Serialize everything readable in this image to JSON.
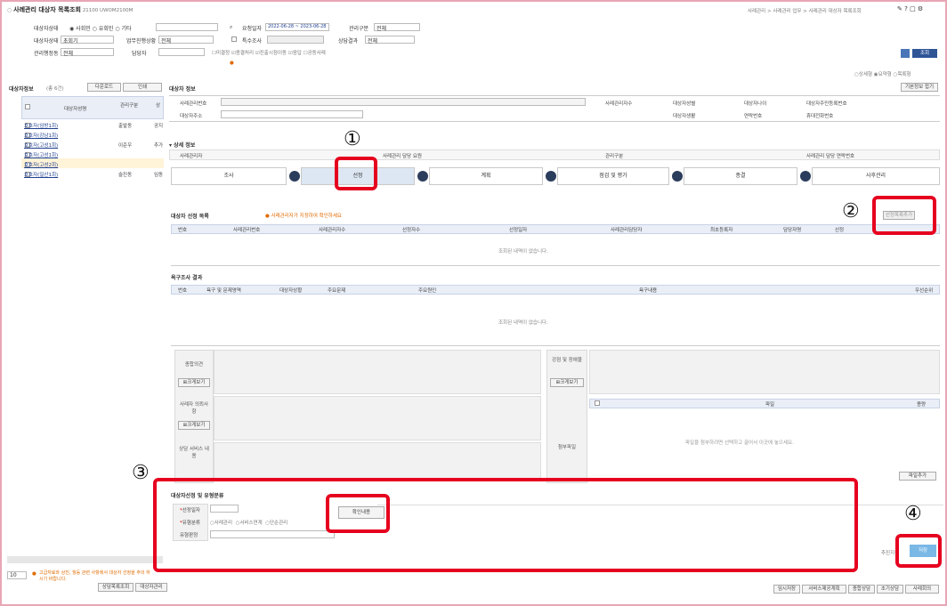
{
  "window": {
    "title": "사례관리 대상자 목록조회",
    "code": "21100 UWOM2100M"
  },
  "header_links": [
    "사례관리",
    "사례관리 업무",
    "사례관리 대상자 목록조회"
  ],
  "filters": {
    "status_label": "대상자상태",
    "status_options": [
      "사회민",
      "유회민",
      "기타"
    ],
    "reg_date_label": "요청일자",
    "reg_date_value": "2022-06-28 ~ 2023-06-28",
    "manage_type_label": "관리구분",
    "manage_type_value": "전체",
    "status2_label": "대상자상태",
    "status2_value": "초회기",
    "org_label": "업무진행상황",
    "org_value": "전체",
    "region_label": "특수조사",
    "consult_label": "상담결과",
    "consult_value": "전체",
    "worker_label": "관리행정동",
    "worker_value": "전체",
    "manager_label": "담당자",
    "checks": [
      "미결정",
      "종결처리",
      "진출시점이동",
      "응답",
      "공동사례"
    ]
  },
  "right_buttons": {
    "search": "조회",
    "radio": [
      "상세형",
      "요약형",
      "목록형"
    ]
  },
  "left_panel": {
    "title": "대상자정보",
    "count": "(총 6건)",
    "btn_excel": "다운로드",
    "btn_layout": "인쇄",
    "columns": [
      "대상자성명",
      "관리구분",
      "상"
    ],
    "rows": [
      {
        "name": "호호자(임방1회)",
        "type": "출발동",
        "c": "공지"
      },
      {
        "name": "호호자(강남1회)",
        "type": "",
        "c": ""
      },
      {
        "name": "호호자(고성1회)",
        "type": "이준우",
        "c": "추가"
      },
      {
        "name": "호호자(고성1회)",
        "type": "",
        "c": ""
      },
      {
        "name": "호호자(고성2회)",
        "type": "",
        "c": ""
      },
      {
        "name": "호호자(일산1회)",
        "type": "슬진동",
        "c": "임동"
      }
    ],
    "pager": "10",
    "footer_btns": [
      "상담목록조회",
      "대상자관리"
    ]
  },
  "detail": {
    "title": "대상자 정보",
    "btn_fold": "기본정보 접기",
    "fields": [
      "사례관리번호",
      "사례관리자수",
      "대상자성별",
      "대상자나이",
      "대상자주민등록번호",
      "대상자주소",
      "대상자생활",
      "연락번호",
      "휴대전화번호"
    ],
    "sub_title": "상세 정보",
    "sub_fields": [
      "사례관리자",
      "사례관리 담당 요원",
      "관리구분",
      "사례관리 담당 연락번호"
    ]
  },
  "steps": [
    "조사",
    "선정",
    "계획",
    "점검 및 평가",
    "종결",
    "사후관리"
  ],
  "selection": {
    "title": "대상자 선정 목록",
    "notice": "사례관리자가 지정하여 확인하세요",
    "btn_register": "선정목록추가",
    "columns": [
      "번호",
      "사례관리번호",
      "사례관리자수",
      "선정자수",
      "선정일자",
      "사례관리담당자",
      "최초등록자",
      "담당자명",
      "선정"
    ],
    "empty": "조회된 내역이 없습니다."
  },
  "needs": {
    "title": "욕구조사 결과",
    "columns": [
      "번호",
      "욕구 및 문제영역",
      "대상자상황",
      "주요문제",
      "주요원인",
      "욕구내용",
      "우선순위"
    ],
    "empty": "조회된 내역이 없습니다."
  },
  "form": {
    "labels": [
      "종합의견",
      "사례자 의뢰사항",
      "상담 서비스 내용"
    ],
    "btn_expand": "크게보기",
    "right_labels": [
      "강점 및 장애물",
      "첨부파일"
    ],
    "attach_cols": [
      "파일",
      "용량"
    ],
    "attach_hint": "파일을 첨부하려면 선택하고 끌어서 이곳에 놓으세요.",
    "attach_btn": "파일추가"
  },
  "decision": {
    "title": "대상자선정 및 유형분류",
    "fields": [
      "선정일자",
      "유형분류",
      "유형판정"
    ],
    "radios": [
      "사례관리",
      "서비스연계",
      "단순관리"
    ],
    "btn": "확인내용"
  },
  "bottom_right": {
    "btn_label": "추진지원",
    "btn_save": "저장"
  },
  "bottom_bar": [
    "임시저장",
    "서비스제공계획",
    "종합상담",
    "초기상담",
    "사례회의"
  ],
  "callouts": [
    "①",
    "②",
    "③",
    "④"
  ],
  "notes": "고급자료와 상진, 월등 관련 사항에서 대상자 선정을 주의 하시기 바랍니다."
}
